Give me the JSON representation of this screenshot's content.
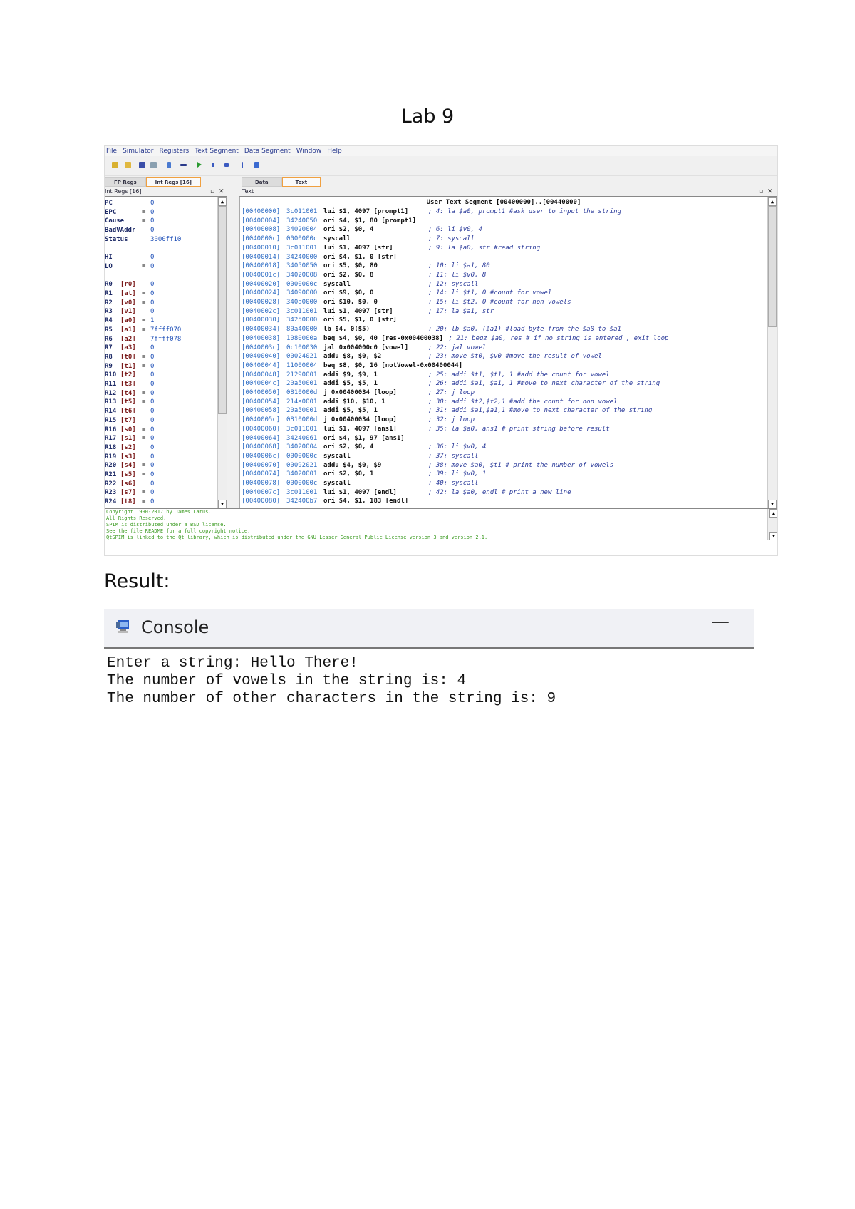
{
  "doc_title": "Lab 9",
  "qtspim": {
    "menu": [
      "File",
      "Simulator",
      "Registers",
      "Text Segment",
      "Data Segment",
      "Window",
      "Help"
    ],
    "left_tabs": [
      "FP Regs",
      "Int Regs [16]"
    ],
    "right_tabs": [
      "Data",
      "Text"
    ],
    "left_panel_title": "Int Regs [16]",
    "right_panel_title": "Text",
    "registers": [
      {
        "n": "PC",
        "a": "",
        "eq": "",
        "v": "0"
      },
      {
        "n": "EPC",
        "a": "",
        "eq": "=",
        "v": "0"
      },
      {
        "n": "Cause",
        "a": "",
        "eq": "=",
        "v": "0"
      },
      {
        "n": "BadVAddr",
        "a": "",
        "eq": "",
        "v": "0"
      },
      {
        "n": "Status",
        "a": "",
        "eq": "",
        "v": "3000ff10"
      },
      {
        "n": "",
        "a": "",
        "eq": "",
        "v": ""
      },
      {
        "n": "HI",
        "a": "",
        "eq": "",
        "v": "0"
      },
      {
        "n": "LO",
        "a": "",
        "eq": "=",
        "v": "0"
      },
      {
        "n": "",
        "a": "",
        "eq": "",
        "v": ""
      },
      {
        "n": "R0",
        "a": "[r0]",
        "eq": "",
        "v": "0"
      },
      {
        "n": "R1",
        "a": "[at]",
        "eq": "=",
        "v": "0"
      },
      {
        "n": "R2",
        "a": "[v0]",
        "eq": "=",
        "v": "0"
      },
      {
        "n": "R3",
        "a": "[v1]",
        "eq": "",
        "v": "0"
      },
      {
        "n": "R4",
        "a": "[a0]",
        "eq": "=",
        "v": "1"
      },
      {
        "n": "R5",
        "a": "[a1]",
        "eq": "=",
        "v": "7ffff070"
      },
      {
        "n": "R6",
        "a": "[a2]",
        "eq": "",
        "v": "7ffff078"
      },
      {
        "n": "R7",
        "a": "[a3]",
        "eq": "",
        "v": "0"
      },
      {
        "n": "R8",
        "a": "[t0]",
        "eq": "=",
        "v": "0"
      },
      {
        "n": "R9",
        "a": "[t1]",
        "eq": "=",
        "v": "0"
      },
      {
        "n": "R10",
        "a": "[t2]",
        "eq": "",
        "v": "0"
      },
      {
        "n": "R11",
        "a": "[t3]",
        "eq": "",
        "v": "0"
      },
      {
        "n": "R12",
        "a": "[t4]",
        "eq": "=",
        "v": "0"
      },
      {
        "n": "R13",
        "a": "[t5]",
        "eq": "=",
        "v": "0"
      },
      {
        "n": "R14",
        "a": "[t6]",
        "eq": "",
        "v": "0"
      },
      {
        "n": "R15",
        "a": "[t7]",
        "eq": "",
        "v": "0"
      },
      {
        "n": "R16",
        "a": "[s0]",
        "eq": "=",
        "v": "0"
      },
      {
        "n": "R17",
        "a": "[s1]",
        "eq": "=",
        "v": "0"
      },
      {
        "n": "R18",
        "a": "[s2]",
        "eq": "",
        "v": "0"
      },
      {
        "n": "R19",
        "a": "[s3]",
        "eq": "",
        "v": "0"
      },
      {
        "n": "R20",
        "a": "[s4]",
        "eq": "=",
        "v": "0"
      },
      {
        "n": "R21",
        "a": "[s5]",
        "eq": "=",
        "v": "0"
      },
      {
        "n": "R22",
        "a": "[s6]",
        "eq": "",
        "v": "0"
      },
      {
        "n": "R23",
        "a": "[s7]",
        "eq": "=",
        "v": "0"
      },
      {
        "n": "R24",
        "a": "[t8]",
        "eq": "=",
        "v": "0"
      }
    ],
    "segment_header": "User Text Segment [00400000]..[00440000]",
    "code": [
      [
        "[00400000]",
        "3c011001",
        "lui $1, 4097 [prompt1]",
        "; 4: la $a0, prompt1 #ask user to input the string"
      ],
      [
        "[00400004]",
        "34240050",
        "ori $4, $1, 80 [prompt1]",
        ""
      ],
      [
        "[00400008]",
        "34020004",
        "ori $2, $0, 4",
        "; 6: li $v0, 4"
      ],
      [
        "[0040000c]",
        "0000000c",
        "syscall",
        "; 7: syscall"
      ],
      [
        "[00400010]",
        "3c011001",
        "lui $1, 4097 [str]",
        "; 9: la $a0, str #read string"
      ],
      [
        "[00400014]",
        "34240000",
        "ori $4, $1, 0 [str]",
        ""
      ],
      [
        "[00400018]",
        "34050050",
        "ori $5, $0, 80",
        "; 10: li $a1, 80"
      ],
      [
        "[0040001c]",
        "34020008",
        "ori $2, $0, 8",
        "; 11: li $v0, 8"
      ],
      [
        "[00400020]",
        "0000000c",
        "syscall",
        "; 12: syscall"
      ],
      [
        "[00400024]",
        "34090000",
        "ori $9, $0, 0",
        "; 14: li $t1, 0 #count for vowel"
      ],
      [
        "[00400028]",
        "340a0000",
        "ori $10, $0, 0",
        "; 15: li $t2, 0 #count for non vowels"
      ],
      [
        "[0040002c]",
        "3c011001",
        "lui $1, 4097 [str]",
        "; 17: la $a1, str"
      ],
      [
        "[00400030]",
        "34250000",
        "ori $5, $1, 0 [str]",
        ""
      ],
      [
        "[00400034]",
        "80a40000",
        "lb $4, 0($5)",
        "; 20: lb $a0, ($a1) #load byte from the $a0 to $a1"
      ],
      [
        "[00400038]",
        "1080000a",
        "beq $4, $0, 40 [res-0x00400038]",
        "; 21: beqz $a0, res # if no string is entered , exit loop"
      ],
      [
        "[0040003c]",
        "0c100030",
        "jal 0x004000c0 [vowel]",
        "; 22: jal vowel"
      ],
      [
        "[00400040]",
        "00024021",
        "addu $8, $0, $2",
        "; 23: move $t0, $v0 #move the result of vowel"
      ],
      [
        "[00400044]",
        "11000004",
        "beq $8, $0, 16 [notVowel-0x00400044]",
        ""
      ],
      [
        "[00400048]",
        "21290001",
        "addi $9, $9, 1",
        "; 25: addi $t1, $t1, 1 #add the count for vowel"
      ],
      [
        "[0040004c]",
        "20a50001",
        "addi $5, $5, 1",
        "; 26: addi $a1, $a1, 1 #move to next character of the string"
      ],
      [
        "[00400050]",
        "0810000d",
        "j 0x00400034 [loop]",
        "; 27: j loop"
      ],
      [
        "[00400054]",
        "214a0001",
        "addi $10, $10, 1",
        "; 30: addi $t2,$t2,1 #add the count for non vowel"
      ],
      [
        "[00400058]",
        "20a50001",
        "addi $5, $5, 1",
        "; 31: addi $a1,$a1,1 #move to next character of the string"
      ],
      [
        "[0040005c]",
        "0810000d",
        "j 0x00400034 [loop]",
        "; 32: j loop"
      ],
      [
        "[00400060]",
        "3c011001",
        "lui $1, 4097 [ans1]",
        "; 35: la $a0, ans1 # print string before result"
      ],
      [
        "[00400064]",
        "34240061",
        "ori $4, $1, 97 [ans1]",
        ""
      ],
      [
        "[00400068]",
        "34020004",
        "ori $2, $0, 4",
        "; 36: li $v0, 4"
      ],
      [
        "[0040006c]",
        "0000000c",
        "syscall",
        "; 37: syscall"
      ],
      [
        "[00400070]",
        "00092021",
        "addu $4, $0, $9",
        "; 38: move $a0, $t1 # print the number of vowels"
      ],
      [
        "[00400074]",
        "34020001",
        "ori $2, $0, 1",
        "; 39: li $v0, 1"
      ],
      [
        "[00400078]",
        "0000000c",
        "syscall",
        "; 40: syscall"
      ],
      [
        "[0040007c]",
        "3c011001",
        "lui $1, 4097 [endl]",
        "; 42: la $a0, endl # print a new line"
      ],
      [
        "[00400080]",
        "342400b7",
        "ori $4, $1, 183 [endl]",
        ""
      ]
    ],
    "messages": [
      "Copyright 1990-2017 by James Larus.",
      "All Rights Reserved.",
      "SPIM is distributed under a BSD license.",
      "See the file README for a full copyright notice.",
      "QtSPIM is linked to the Qt library, which is distributed under the GNU Lesser General Public License version 3 and version 2.1."
    ]
  },
  "result_label": "Result:",
  "console": {
    "title": "Console",
    "minimize": "—",
    "output": [
      "Enter a string: Hello There!",
      "The number of vowels in the string is: 4",
      "The number of other characters in the string is: 9"
    ]
  }
}
